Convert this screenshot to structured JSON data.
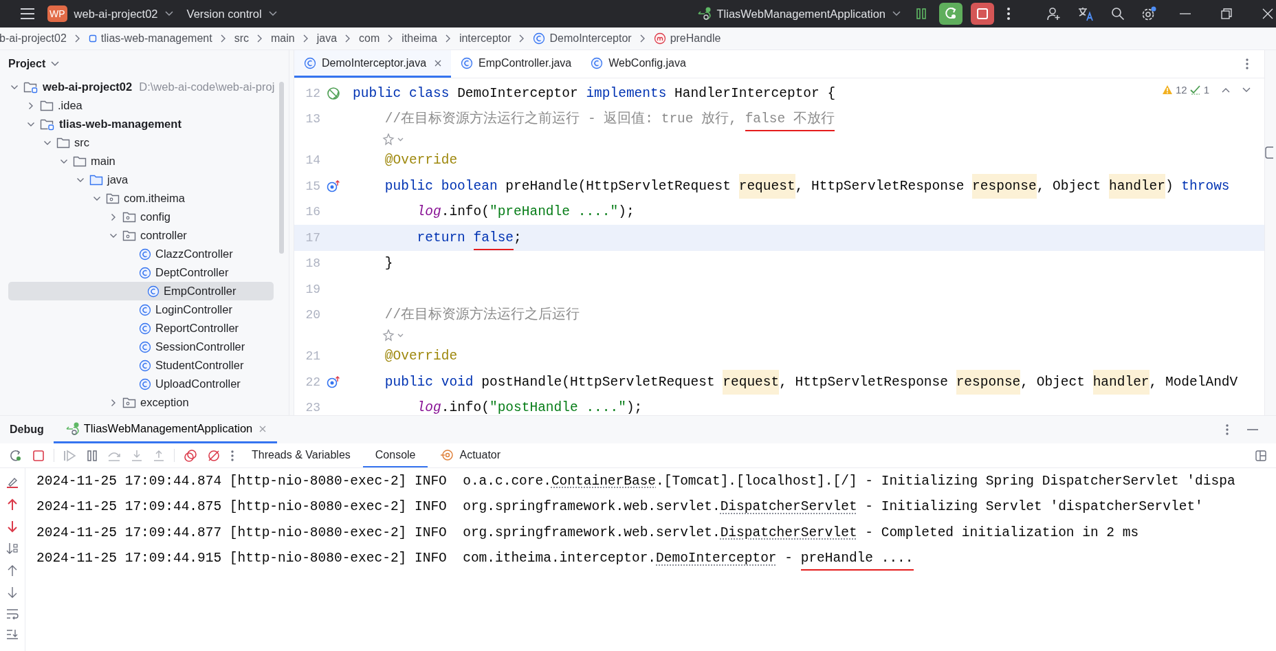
{
  "title_bar": {
    "project_badge": "WP",
    "project": "web-ai-project02",
    "vcs": "Version control",
    "run_config": "TliasWebManagementApplication"
  },
  "breadcrumb": [
    {
      "label": "b-ai-project02",
      "kind": "plain"
    },
    {
      "label": "tlias-web-management",
      "kind": "module"
    },
    {
      "label": "src",
      "kind": "plain"
    },
    {
      "label": "main",
      "kind": "plain"
    },
    {
      "label": "java",
      "kind": "plain"
    },
    {
      "label": "com",
      "kind": "plain"
    },
    {
      "label": "itheima",
      "kind": "plain"
    },
    {
      "label": "interceptor",
      "kind": "plain"
    },
    {
      "label": "DemoInterceptor",
      "kind": "class"
    },
    {
      "label": "preHandle",
      "kind": "method"
    }
  ],
  "project_panel": {
    "title": "Project",
    "tree": [
      {
        "label": "web-ai-project02",
        "path": "D:\\web-ai-code\\web-ai-proj",
        "kind": "module",
        "expanded": true,
        "selected": false,
        "children": [
          {
            "label": ".idea",
            "kind": "folder",
            "expanded": false,
            "selected": false
          },
          {
            "label": "tlias-web-management",
            "kind": "module",
            "expanded": true,
            "selected": false,
            "children": [
              {
                "label": "src",
                "kind": "folder",
                "expanded": true,
                "selected": false,
                "children": [
                  {
                    "label": "main",
                    "kind": "folder",
                    "expanded": true,
                    "selected": false,
                    "children": [
                      {
                        "label": "java",
                        "kind": "source",
                        "expanded": true,
                        "selected": false,
                        "children": [
                          {
                            "label": "com.itheima",
                            "kind": "package",
                            "expanded": true,
                            "selected": false,
                            "children": [
                              {
                                "label": "config",
                                "kind": "package",
                                "expanded": false,
                                "selected": false
                              },
                              {
                                "label": "controller",
                                "kind": "package",
                                "expanded": true,
                                "selected": false,
                                "children": [
                                  {
                                    "label": "ClazzController",
                                    "kind": "class",
                                    "selected": false
                                  },
                                  {
                                    "label": "DeptController",
                                    "kind": "class",
                                    "selected": false
                                  },
                                  {
                                    "label": "EmpController",
                                    "kind": "class",
                                    "selected": true
                                  },
                                  {
                                    "label": "LoginController",
                                    "kind": "class",
                                    "selected": false
                                  },
                                  {
                                    "label": "ReportController",
                                    "kind": "class",
                                    "selected": false
                                  },
                                  {
                                    "label": "SessionController",
                                    "kind": "class",
                                    "selected": false
                                  },
                                  {
                                    "label": "StudentController",
                                    "kind": "class",
                                    "selected": false
                                  },
                                  {
                                    "label": "UploadController",
                                    "kind": "class",
                                    "selected": false
                                  }
                                ]
                              },
                              {
                                "label": "exception",
                                "kind": "package",
                                "expanded": false,
                                "selected": false
                              }
                            ]
                          }
                        ]
                      }
                    ]
                  }
                ]
              }
            ]
          }
        ]
      }
    ]
  },
  "editor": {
    "tabs": [
      {
        "label": "DemoInterceptor.java",
        "selected": true,
        "closable": true
      },
      {
        "label": "EmpController.java",
        "selected": false,
        "closable": false
      },
      {
        "label": "WebConfig.java",
        "selected": false,
        "closable": false
      }
    ],
    "inspections": {
      "warnings": "12",
      "weak_warnings": "1"
    },
    "lines": [
      {
        "kind": "code",
        "number": "12",
        "gutter": {
          "kind": "bean"
        },
        "current": false,
        "segments": [
          {
            "text": "public class",
            "kind": "kw",
            "underlined": false
          },
          {
            "text": " DemoInterceptor ",
            "kind": "plain",
            "underlined": false
          },
          {
            "text": "implements",
            "kind": "kw",
            "underlined": false
          },
          {
            "text": " HandlerInterceptor {",
            "kind": "plain",
            "underlined": false
          }
        ]
      },
      {
        "kind": "code",
        "number": "13",
        "current": false,
        "segments": [
          {
            "text": "    //在目标资源方法运行之前运行 - 返回值: true 放行, ",
            "kind": "comment",
            "underlined": false
          },
          {
            "text": "false 不放行",
            "kind": "comment",
            "underlined": true
          }
        ]
      },
      {
        "kind": "hint"
      },
      {
        "kind": "code",
        "number": "14",
        "current": false,
        "segments": [
          {
            "text": "    @Override",
            "kind": "ann",
            "underlined": false
          }
        ]
      },
      {
        "kind": "code",
        "number": "15",
        "gutter": {
          "kind": "implements"
        },
        "current": false,
        "segments": [
          {
            "text": "    public boolean",
            "kind": "kw",
            "underlined": false
          },
          {
            "text": " preHandle(HttpServletRequest ",
            "kind": "plain",
            "underlined": false
          },
          {
            "text": "request",
            "kind": "param",
            "underlined": false
          },
          {
            "text": ", HttpServletResponse ",
            "kind": "plain",
            "underlined": false
          },
          {
            "text": "response",
            "kind": "param",
            "underlined": false
          },
          {
            "text": ", Object ",
            "kind": "plain",
            "underlined": false
          },
          {
            "text": "handler",
            "kind": "param",
            "underlined": false
          },
          {
            "text": ") ",
            "kind": "plain",
            "underlined": false
          },
          {
            "text": "throws",
            "kind": "kw",
            "underlined": false
          }
        ]
      },
      {
        "kind": "code",
        "number": "16",
        "current": false,
        "segments": [
          {
            "text": "        log",
            "kind": "field",
            "underlined": false
          },
          {
            "text": ".info(",
            "kind": "plain",
            "underlined": false
          },
          {
            "text": "\"preHandle ....\"",
            "kind": "str",
            "underlined": false
          },
          {
            "text": ");",
            "kind": "plain",
            "underlined": false
          }
        ]
      },
      {
        "kind": "code",
        "number": "17",
        "current": true,
        "segments": [
          {
            "text": "        return ",
            "kind": "kw",
            "underlined": false
          },
          {
            "text": "false",
            "kind": "kw",
            "underlined": true
          },
          {
            "text": ";",
            "kind": "plain",
            "underlined": false
          }
        ]
      },
      {
        "kind": "code",
        "number": "18",
        "current": false,
        "segments": [
          {
            "text": "    }",
            "kind": "plain",
            "underlined": false
          }
        ]
      },
      {
        "kind": "code",
        "number": "19",
        "current": false
      },
      {
        "kind": "code",
        "number": "20",
        "current": false,
        "segments": [
          {
            "text": "    //在目标资源方法运行之后运行",
            "kind": "comment",
            "underlined": false
          }
        ]
      },
      {
        "kind": "hint"
      },
      {
        "kind": "code",
        "number": "21",
        "current": false,
        "segments": [
          {
            "text": "    @Override",
            "kind": "ann",
            "underlined": false
          }
        ]
      },
      {
        "kind": "code",
        "number": "22",
        "gutter": {
          "kind": "implements"
        },
        "current": false,
        "segments": [
          {
            "text": "    public void",
            "kind": "kw",
            "underlined": false
          },
          {
            "text": " postHandle(HttpServletRequest ",
            "kind": "plain",
            "underlined": false
          },
          {
            "text": "request",
            "kind": "param",
            "underlined": false
          },
          {
            "text": ", HttpServletResponse ",
            "kind": "plain",
            "underlined": false
          },
          {
            "text": "response",
            "kind": "param",
            "underlined": false
          },
          {
            "text": ", Object ",
            "kind": "plain",
            "underlined": false
          },
          {
            "text": "handler",
            "kind": "param",
            "underlined": false
          },
          {
            "text": ", ModelAndV",
            "kind": "plain",
            "underlined": false
          }
        ]
      },
      {
        "kind": "code",
        "number": "23",
        "current": false,
        "segments": [
          {
            "text": "        log",
            "kind": "field"
          },
          {
            "text": ".info(",
            "kind": "plain"
          },
          {
            "text": "\"postHandle ....\"",
            "kind": "str"
          },
          {
            "text": ");",
            "kind": "plain"
          }
        ]
      }
    ]
  },
  "debug_panel": {
    "title": "Debug",
    "session_tab": {
      "label": "TliasWebManagementApplication",
      "selected": true
    },
    "tabs": [
      {
        "label": "Threads & Variables",
        "selected": false,
        "kind": "plain"
      },
      {
        "label": "Console",
        "selected": true,
        "kind": "plain"
      },
      {
        "label": "Actuator",
        "selected": false,
        "kind": "actuator"
      }
    ],
    "console": [
      {
        "segments": [
          {
            "text": "2024-11-25 17:09:44.874 [http-nio-8080-exec-2] INFO  o.a.c.core.",
            "link": false,
            "underlined": false
          },
          {
            "text": "ContainerBase",
            "link": true,
            "underlined": false
          },
          {
            "text": ".[Tomcat].[localhost].[/] - Initializing Spring DispatcherServlet 'dispa",
            "link": false,
            "underlined": false
          }
        ]
      },
      {
        "segments": [
          {
            "text": "2024-11-25 17:09:44.875 [http-nio-8080-exec-2] INFO  org.springframework.web.servlet.",
            "link": false,
            "underlined": false
          },
          {
            "text": "DispatcherServlet",
            "link": true,
            "underlined": false
          },
          {
            "text": " - Initializing Servlet 'dispatcherServlet'",
            "link": false,
            "underlined": false
          }
        ]
      },
      {
        "segments": [
          {
            "text": "2024-11-25 17:09:44.877 [http-nio-8080-exec-2] INFO  org.springframework.web.servlet.",
            "link": false,
            "underlined": false
          },
          {
            "text": "DispatcherServlet",
            "link": true,
            "underlined": false
          },
          {
            "text": " - Completed initialization in 2 ms",
            "link": false,
            "underlined": false
          }
        ]
      },
      {
        "segments": [
          {
            "text": "2024-11-25 17:09:44.915 [http-nio-8080-exec-2] INFO  com.itheima.interceptor.",
            "link": false,
            "underlined": false
          },
          {
            "text": "DemoInterceptor",
            "link": true,
            "underlined": false
          },
          {
            "text": " - ",
            "link": false,
            "underlined": false
          },
          {
            "text": "preHandle ....",
            "link": false,
            "underlined": true
          }
        ]
      }
    ]
  }
}
